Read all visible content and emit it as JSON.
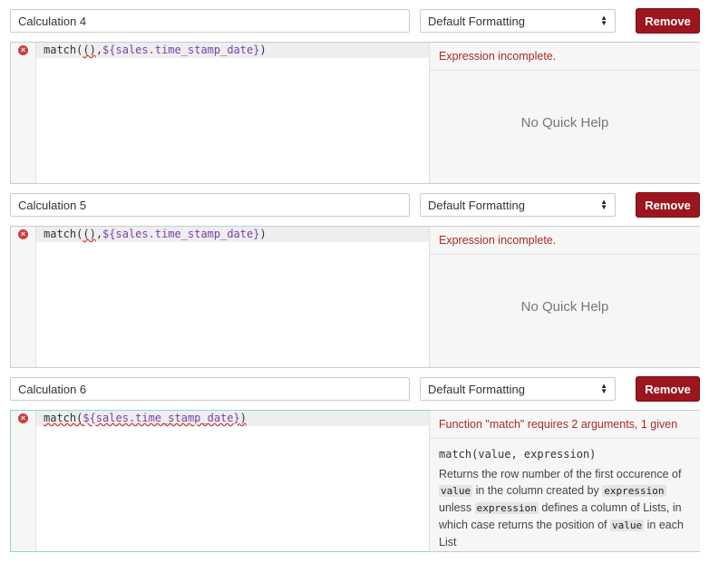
{
  "calculations": [
    {
      "name": "Calculation 4",
      "formatting": "Default Formatting",
      "remove_label": "Remove",
      "code_parts": [
        "match(",
        "()",
        ",",
        "${sales.time_stamp_date}",
        ")"
      ],
      "status": "Expression incomplete.",
      "quick_help": "No Quick Help"
    },
    {
      "name": "Calculation 5",
      "formatting": "Default Formatting",
      "remove_label": "Remove",
      "code_parts": [
        "match(",
        "()",
        ",",
        "${sales.time_stamp_date}",
        ")"
      ],
      "status": "Expression incomplete.",
      "quick_help": "No Quick Help"
    },
    {
      "name": "Calculation 6",
      "formatting": "Default Formatting",
      "remove_label": "Remove",
      "code_parts": [
        "match(",
        "${sales.time_stamp_date}",
        ")"
      ],
      "status": "Function \"match\" requires 2 arguments, 1 given",
      "help": {
        "signature": "match(value, expression)",
        "desc_1": "Returns the row number of the first occurence of",
        "kw_value": "value",
        "desc_2": "in the column created by",
        "kw_expression": "expression",
        "desc_3": "unless",
        "desc_4": "defines a column of Lists, in which case returns the position of",
        "desc_5": "in each List"
      }
    }
  ],
  "colors": {
    "remove_bg": "#9c1620",
    "error_text": "#a82a2a",
    "variable": "#7b3fa8",
    "active_border": "#8fd3d8"
  },
  "icons": {
    "error": "error-x-icon",
    "select_arrows": "select-arrows-icon"
  }
}
